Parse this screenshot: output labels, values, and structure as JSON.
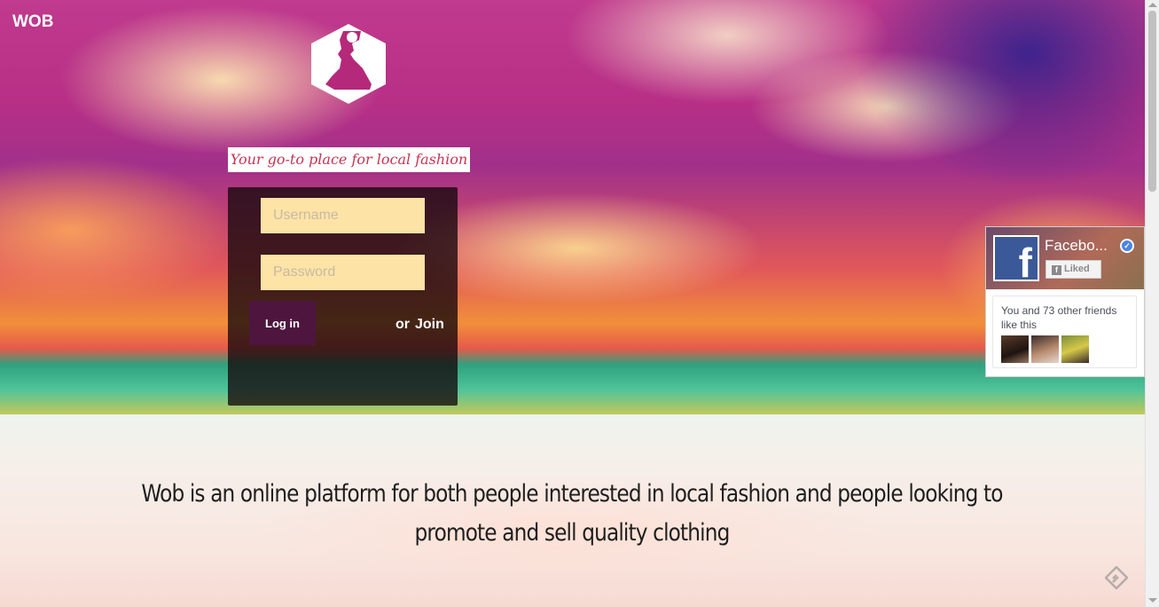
{
  "header": {
    "brand": "WOB"
  },
  "hero": {
    "tagline": "Your go-to place for local fashion"
  },
  "login": {
    "username_placeholder": "Username",
    "password_placeholder": "Password",
    "login_label": "Log in",
    "or_label": "or",
    "join_label": "Join"
  },
  "facebook_widget": {
    "page_name": "Facebo...",
    "liked_label": "Liked",
    "friends_text": "You and 73 other friends like this"
  },
  "main": {
    "description": "Wob is an online platform for both people interested in local fashion and people looking to promote and sell quality clothing"
  },
  "colors": {
    "logo_accent": "#b5297a",
    "tagline_color": "#c8334f",
    "input_bg": "#fde3a6",
    "facebook_blue": "#3b5998"
  },
  "icons": [
    "wob-logo-icon",
    "facebook-logo-icon",
    "verified-badge-icon",
    "thumbs-up-icon",
    "feedly-icon"
  ]
}
